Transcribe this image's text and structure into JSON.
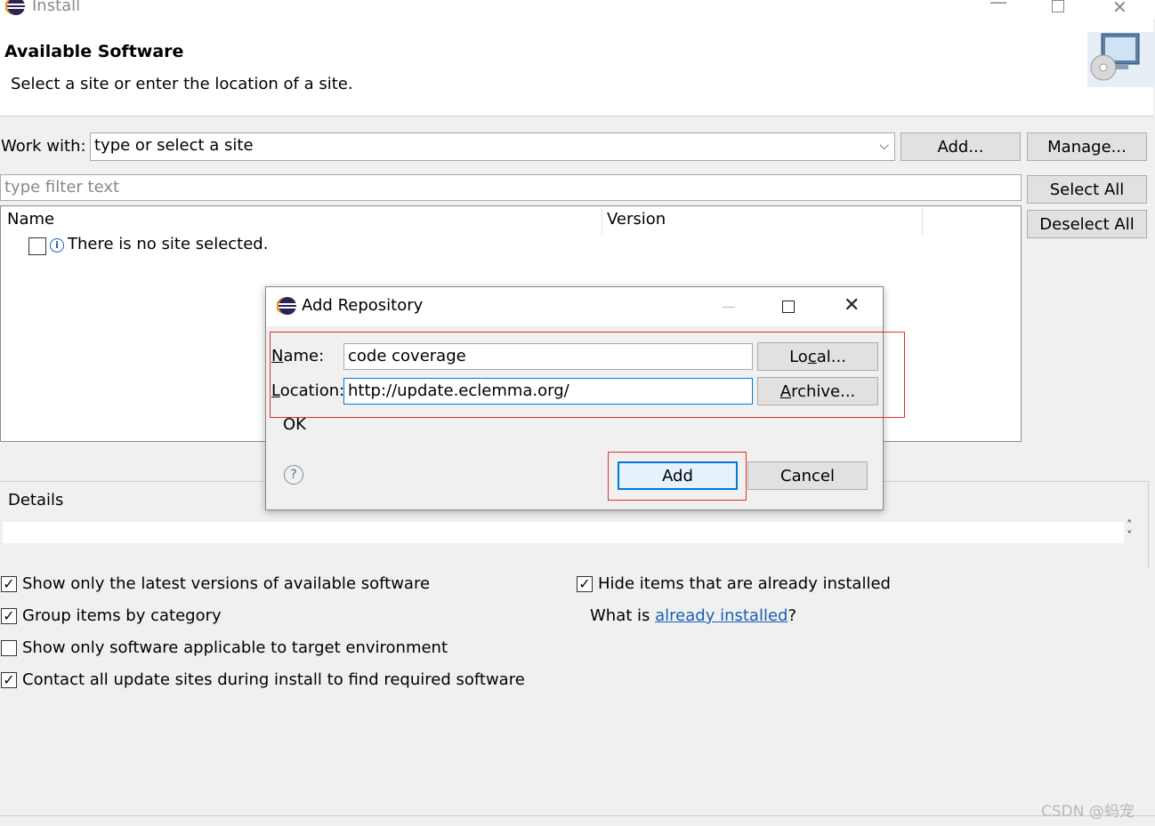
{
  "window": {
    "title": "Install"
  },
  "header": {
    "title": "Available Software",
    "subtitle": "Select a site or enter the location of a site."
  },
  "work_with": {
    "label": "Work with:",
    "value": "type or select a site",
    "add_label": "Add...",
    "manage_label": "Manage..."
  },
  "filter": {
    "placeholder": "type filter text",
    "select_all_label": "Select All",
    "deselect_all_label": "Deselect All"
  },
  "table": {
    "columns": [
      "Name",
      "Version"
    ],
    "rows": [
      {
        "name": "There is no site selected.",
        "checked": false
      }
    ]
  },
  "details": {
    "label": "Details"
  },
  "options": {
    "left": [
      {
        "label": "Show only the latest versions of available software",
        "checked": true
      },
      {
        "label": "Group items by category",
        "checked": true
      },
      {
        "label": "Show only software applicable to target environment",
        "checked": false
      },
      {
        "label": "Contact all update sites during install to find required software",
        "checked": true
      }
    ],
    "right": [
      {
        "label": "Hide items that are already installed",
        "checked": true
      }
    ],
    "what_is_prefix": "What is ",
    "what_is_link": "already installed",
    "what_is_suffix": "?"
  },
  "dialog": {
    "title": "Add Repository",
    "name_label_mn": "N",
    "name_label_rest": "ame:",
    "name_value": "code coverage",
    "location_label_mn": "L",
    "location_label_rest": "ocation:",
    "location_value": "http://update.eclemma.org/",
    "local_label_pre": "Lo",
    "local_label_mn": "c",
    "local_label_post": "al...",
    "archive_label_mn": "A",
    "archive_label_rest": "rchive...",
    "status": "OK",
    "add_label": "Add",
    "cancel_label": "Cancel"
  },
  "watermark": "CSDN @蚂宠",
  "colors": {
    "highlight": "#e03030",
    "link": "#1a5fb4",
    "focus": "#0078d7"
  }
}
